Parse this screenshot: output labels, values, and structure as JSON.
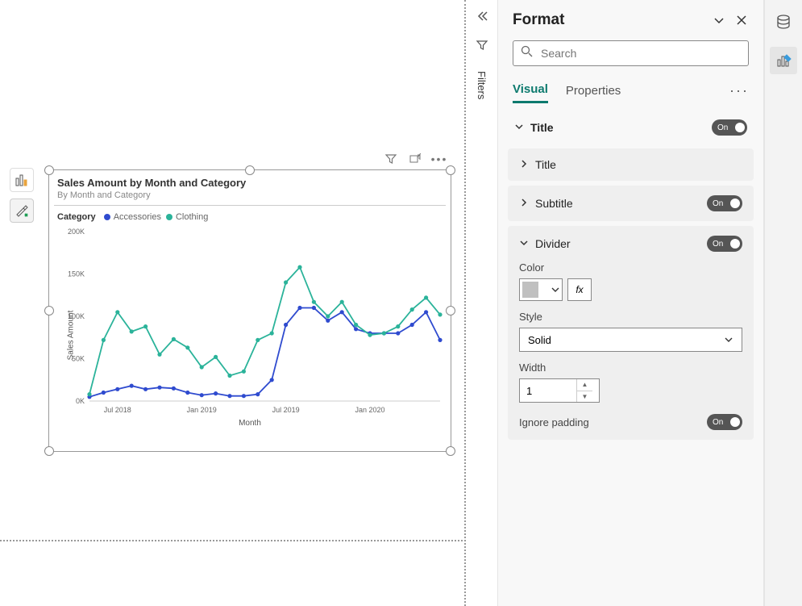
{
  "canvas": {
    "rail": {
      "fields_tip": "Fields",
      "format_tip": "Format"
    }
  },
  "chart_data": {
    "type": "line",
    "title": "Sales Amount by Month and Category",
    "subtitle": "By Month and Category",
    "xlabel": "Month",
    "ylabel": "Sales Amount",
    "legend_label": "Category",
    "y_ticks": [
      "0K",
      "50K",
      "100K",
      "150K",
      "200K"
    ],
    "ylim": [
      0,
      200000
    ],
    "x_ticks": [
      "Jul 2018",
      "Jan 2019",
      "Jul 2019",
      "Jan 2020"
    ],
    "categories": [
      "May 2018",
      "Jun 2018",
      "Jul 2018",
      "Aug 2018",
      "Sep 2018",
      "Oct 2018",
      "Nov 2018",
      "Dec 2018",
      "Jan 2019",
      "Feb 2019",
      "Mar 2019",
      "Apr 2019",
      "May 2019",
      "Jun 2019",
      "Jul 2019",
      "Aug 2019",
      "Sep 2019",
      "Oct 2019",
      "Nov 2019",
      "Dec 2019",
      "Jan 2020",
      "Feb 2020",
      "Mar 2020",
      "Apr 2020",
      "May 2020",
      "Jun 2020"
    ],
    "series": [
      {
        "name": "Accessories",
        "color": "#2f4bcf",
        "values": [
          5000,
          10000,
          14000,
          18000,
          14000,
          16000,
          15000,
          10000,
          7000,
          9000,
          6000,
          6000,
          8000,
          25000,
          90000,
          110000,
          110000,
          95000,
          105000,
          85000,
          80000,
          80000,
          80000,
          90000,
          105000,
          72000
        ]
      },
      {
        "name": "Clothing",
        "color": "#2bb39a",
        "values": [
          8000,
          72000,
          105000,
          82000,
          88000,
          55000,
          73000,
          63000,
          40000,
          52000,
          30000,
          35000,
          72000,
          80000,
          140000,
          158000,
          117000,
          100000,
          117000,
          90000,
          78000,
          80000,
          88000,
          108000,
          122000,
          102000
        ]
      }
    ]
  },
  "filters_pane": {
    "label": "Filters"
  },
  "format_pane": {
    "title": "Format",
    "search_placeholder": "Search",
    "tabs": {
      "visual": "Visual",
      "properties": "Properties"
    },
    "sections": {
      "title": {
        "label": "Title",
        "on": "On"
      },
      "title_inner": {
        "label": "Title"
      },
      "subtitle": {
        "label": "Subtitle",
        "on": "On"
      },
      "divider": {
        "label": "Divider",
        "on": "On",
        "color_label": "Color",
        "fx": "fx",
        "style_label": "Style",
        "style_value": "Solid",
        "width_label": "Width",
        "width_value": "1",
        "ignore_padding_label": "Ignore padding",
        "ignore_padding_on": "On"
      }
    }
  }
}
